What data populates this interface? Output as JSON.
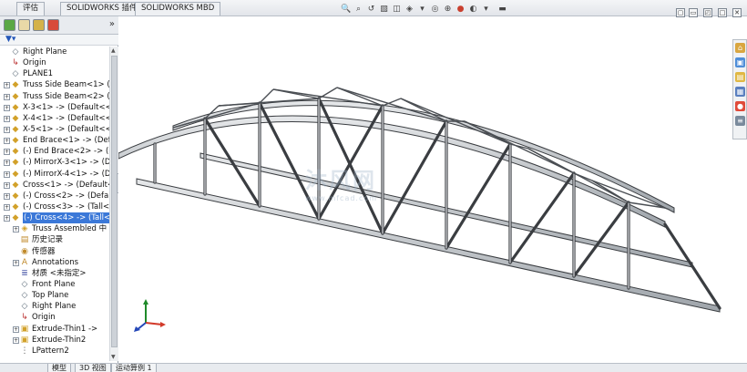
{
  "top_tabs": [
    "评估",
    "SOLIDWORKS 插件",
    "SOLIDWORKS MBD"
  ],
  "feature_tree": {
    "filter_icon": "filter-icon",
    "items": [
      {
        "label": "Right Plane",
        "icon": "plane-icon",
        "expandable": false,
        "selected": false
      },
      {
        "label": "Origin",
        "icon": "origin-icon",
        "expandable": false,
        "selected": false
      },
      {
        "label": "PLANE1",
        "icon": "plane-icon",
        "expandable": false,
        "selected": false
      },
      {
        "label": "Truss Side Beam<1> (",
        "icon": "part-icon",
        "expandable": true,
        "selected": false
      },
      {
        "label": "Truss Side Beam<2> (",
        "icon": "part-icon",
        "expandable": true,
        "selected": false
      },
      {
        "label": "X-3<1> -> (Default<<",
        "icon": "part-icon",
        "expandable": true,
        "selected": false
      },
      {
        "label": "X-4<1> -> (Default<<",
        "icon": "part-icon",
        "expandable": true,
        "selected": false
      },
      {
        "label": "X-5<1> -> (Default<<",
        "icon": "part-icon",
        "expandable": true,
        "selected": false
      },
      {
        "label": "End Brace<1> -> (Def",
        "icon": "part-icon",
        "expandable": true,
        "selected": false
      },
      {
        "label": "(-) End Brace<2> -> (D",
        "icon": "part-icon",
        "expandable": true,
        "selected": false
      },
      {
        "label": "(-) MirrorX-3<1> -> (D",
        "icon": "part-icon",
        "expandable": true,
        "selected": false
      },
      {
        "label": "(-) MirrorX-4<1> -> (D",
        "icon": "part-icon",
        "expandable": true,
        "selected": false
      },
      {
        "label": "Cross<1> -> (Default<",
        "icon": "part-icon",
        "expandable": true,
        "selected": false
      },
      {
        "label": "(-) Cross<2> -> (Defa",
        "icon": "part-icon",
        "expandable": true,
        "selected": false
      },
      {
        "label": "(-) Cross<3> -> (Tall<",
        "icon": "part-icon",
        "expandable": true,
        "selected": false
      },
      {
        "label": "(-) Cross<4> -> (Tall<",
        "icon": "part-icon",
        "expandable": true,
        "selected": true
      },
      {
        "label": "Truss Assembled 中",
        "icon": "assembly-icon",
        "expandable": true,
        "selected": false,
        "indent": 1
      },
      {
        "label": "历史记录",
        "icon": "history-icon",
        "expandable": false,
        "selected": false,
        "indent": 1
      },
      {
        "label": "传感器",
        "icon": "sensor-icon",
        "expandable": false,
        "selected": false,
        "indent": 1
      },
      {
        "label": "Annotations",
        "icon": "annotations-icon",
        "expandable": true,
        "selected": false,
        "indent": 1
      },
      {
        "label": "材质 <未指定>",
        "icon": "material-icon",
        "expandable": false,
        "selected": false,
        "indent": 1
      },
      {
        "label": "Front Plane",
        "icon": "plane-icon",
        "expandable": false,
        "selected": false,
        "indent": 1
      },
      {
        "label": "Top Plane",
        "icon": "plane-icon",
        "expandable": false,
        "selected": false,
        "indent": 1
      },
      {
        "label": "Right Plane",
        "icon": "plane-icon",
        "expandable": false,
        "selected": false,
        "indent": 1
      },
      {
        "label": "Origin",
        "icon": "origin-icon",
        "expandable": false,
        "selected": false,
        "indent": 1
      },
      {
        "label": "Extrude-Thin1 ->",
        "icon": "extrude-icon",
        "expandable": true,
        "selected": false,
        "indent": 1
      },
      {
        "label": "Extrude-Thin2",
        "icon": "extrude-icon",
        "expandable": true,
        "selected": false,
        "indent": 1
      },
      {
        "label": "LPattern2",
        "icon": "pattern-icon",
        "expandable": false,
        "selected": false,
        "indent": 1
      }
    ]
  },
  "bottom_tabs": [
    "模型",
    "3D 视图",
    "运动算例 1"
  ],
  "watermark": {
    "text": "沐风网",
    "sub": "www.mfcad.com"
  },
  "colors": {
    "selection": "#3b78d8",
    "accent": "#2356b8"
  }
}
